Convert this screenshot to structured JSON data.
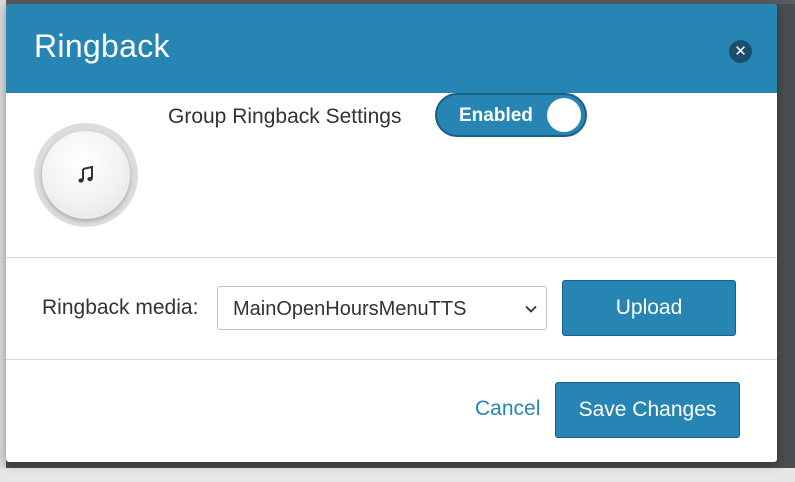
{
  "modal": {
    "title": "Ringback",
    "close_icon": "close-circle-icon"
  },
  "settings": {
    "icon": "music-note-icon",
    "label": "Group Ringback Settings",
    "toggle": {
      "label": "Enabled",
      "state": "on"
    }
  },
  "media": {
    "label": "Ringback media:",
    "selected": "MainOpenHoursMenuTTS",
    "upload_label": "Upload"
  },
  "actions": {
    "cancel_label": "Cancel",
    "save_label": "Save Changes"
  },
  "colors": {
    "accent": "#2785b4",
    "close_bg": "#1a4e6e"
  }
}
